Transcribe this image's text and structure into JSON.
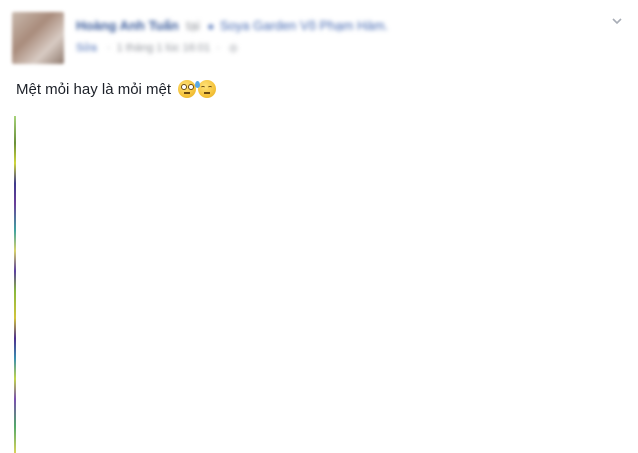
{
  "post": {
    "author": "Hoàng Anh Tuấn",
    "at_text": "tại",
    "location": "Soya Garden Võ Phạm Hàm.",
    "edit_label": "Sửa",
    "timestamp": "1 tháng 1 lúc 16:01",
    "text": "Mệt mỏi hay là mỏi mệt",
    "emojis": [
      "rolling-eyes-emoji",
      "sweat-face-emoji"
    ],
    "icons": {
      "options": "chevron-down-icon",
      "location": "pin-icon",
      "privacy": "globe-icon"
    },
    "colors": {
      "link": "#365899",
      "text": "#1d2129",
      "meta": "#90949c"
    }
  }
}
